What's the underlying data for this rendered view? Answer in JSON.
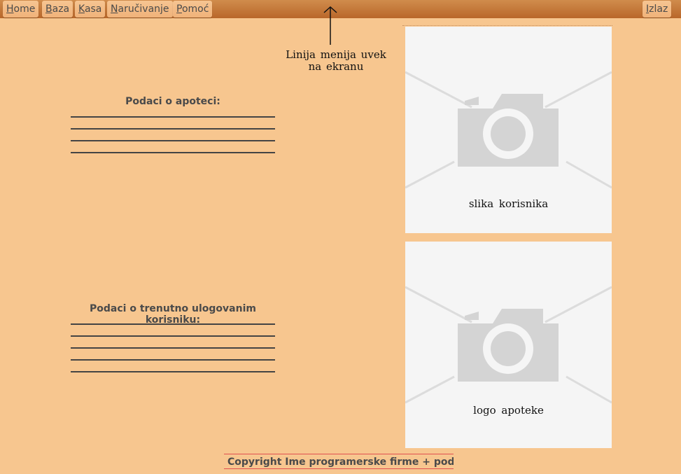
{
  "menu": {
    "home": {
      "hotkey": "H",
      "rest": "ome"
    },
    "baza": {
      "hotkey": "B",
      "rest": "aza"
    },
    "kasa": {
      "hotkey": "K",
      "rest": "asa"
    },
    "narucivanje": {
      "hotkey": "N",
      "rest": "aručivanje"
    },
    "pomoc": {
      "hotkey": "P",
      "rest": "omoć"
    },
    "izlaz": {
      "hotkey": "I",
      "rest": "zlaz"
    }
  },
  "annotation": {
    "line1": "Linija menija uvek",
    "line2": "na ekranu"
  },
  "pharmacy_section": {
    "title": "Podaci o apoteci:"
  },
  "user_section": {
    "title": "Podaci o trenutno ulogovanim korisniku:"
  },
  "images": {
    "user_photo_caption": "slika korisnika",
    "logo_caption": "logo apoteke"
  },
  "footer": {
    "text": "Copyright   Ime programerske firme +  podaci"
  },
  "colors": {
    "background": "#f7c68f",
    "menubar": "#c07532",
    "placeholder": "#f5f5f5"
  }
}
